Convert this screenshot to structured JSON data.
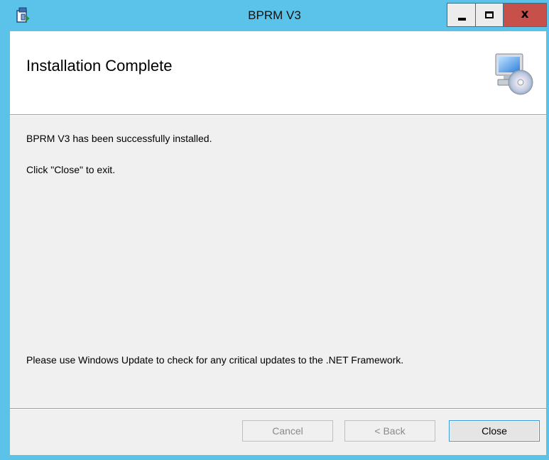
{
  "window": {
    "title": "BPRM V3",
    "app_icon": "installer-icon",
    "controls": {
      "minimize_icon": "minimize-icon",
      "maximize_icon": "maximize-icon",
      "close_glyph": "x"
    },
    "colors": {
      "titlebar": "#5bc3ea",
      "close_button": "#c7504b",
      "client_background": "#f0f0f0",
      "header_background": "#ffffff"
    }
  },
  "header": {
    "title": "Installation Complete",
    "icon": "computer-cd-icon"
  },
  "content": {
    "success_message": "BPRM V3 has been successfully installed.",
    "exit_instruction": "Click \"Close\" to exit.",
    "update_notice": "Please use Windows Update to check for any critical updates to the .NET Framework."
  },
  "footer": {
    "cancel_label": "Cancel",
    "back_label": "< Back",
    "close_label": "Close"
  }
}
